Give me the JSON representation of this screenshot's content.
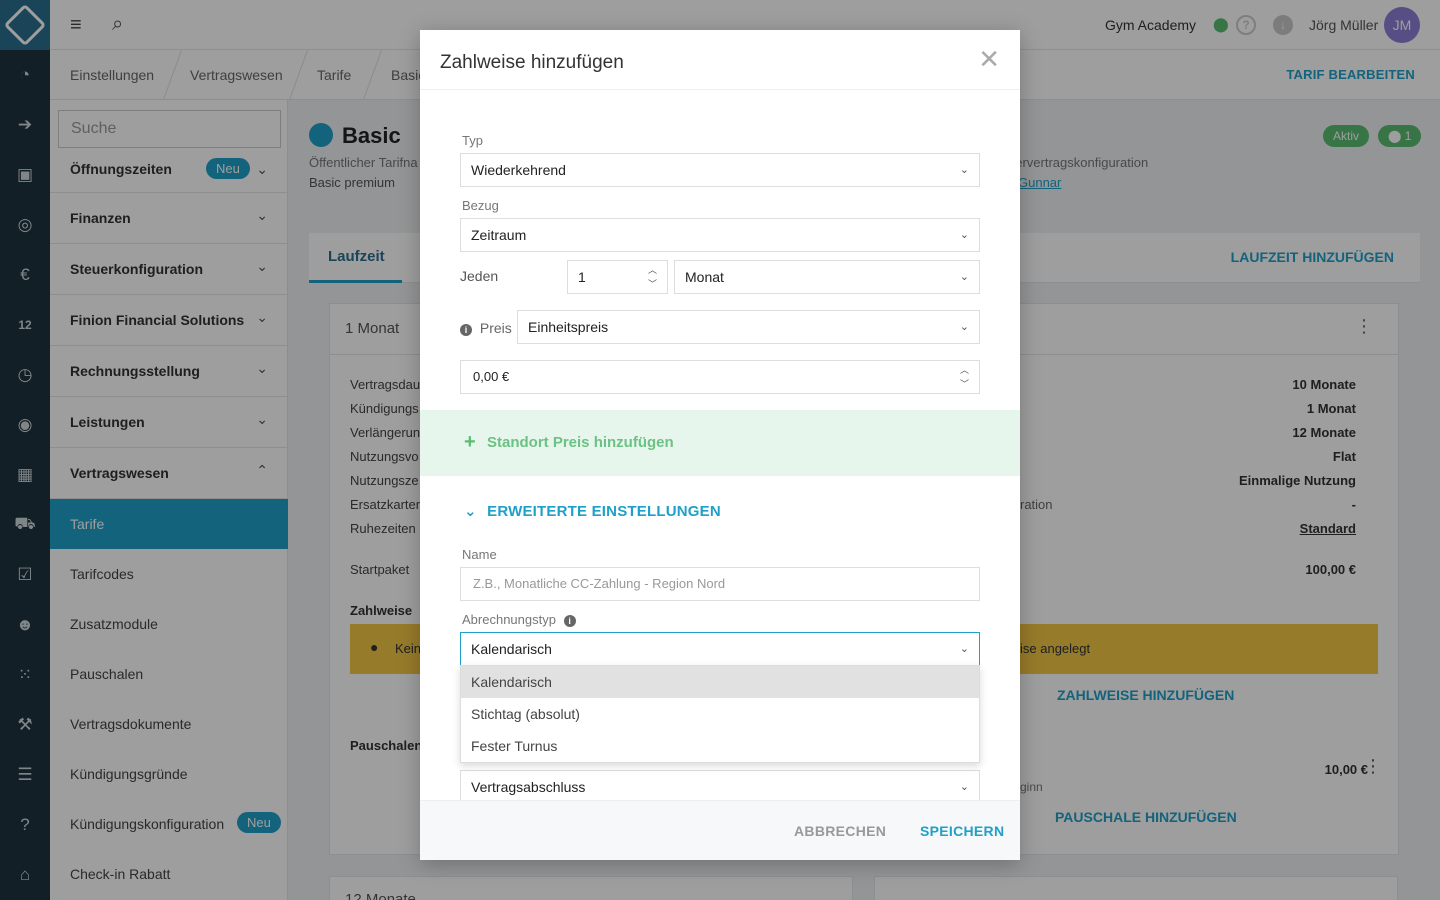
{
  "colors": {
    "accent": "#1fa0c9",
    "rail": "#1f3340",
    "success": "#5bbd72"
  },
  "topbar": {
    "studio": "Gym Academy",
    "user": "Jörg Müller",
    "avatar": "JM",
    "menu_icon": "hamburger-icon",
    "search_icon": "search-icon"
  },
  "rail_icons": [
    "dashboard-icon",
    "login-icon",
    "contacts-icon",
    "target-icon",
    "euro-icon",
    "calendar-icon",
    "timer-icon",
    "chat-icon",
    "chart-icon",
    "cart-icon",
    "check-icon",
    "users-icon",
    "grid-icon",
    "dumbbell-icon",
    "sliders-icon",
    "help-icon",
    "building-icon"
  ],
  "calendar_day": "12",
  "breadcrumb": {
    "items": [
      "Einstellungen",
      "Vertragswesen",
      "Tarife",
      "Basic"
    ],
    "edit_label": "TARIF BEARBEITEN"
  },
  "leftnav": {
    "search_placeholder": "Suche",
    "sections": [
      "Öffnungszeiten",
      "Finanzen",
      "Steuerkonfiguration",
      "Finion Financial Solutions",
      "Rechnungsstellung",
      "Leistungen",
      "Vertragswesen"
    ],
    "new_badge": "Neu",
    "sub_items": [
      "Tarife",
      "Tarifcodes",
      "Zusatzmodule",
      "Pauschalen",
      "Vertragsdokumente",
      "Kündigungsgründe",
      "Kündigungskonfiguration",
      "Check-in Rabatt"
    ]
  },
  "main": {
    "title": "Basic",
    "subtitle1": "Öffentlicher Tarifna",
    "subtitle2": "Basic premium",
    "subtitle3": "nervertragskonfiguration",
    "subtitle4": "Gunnar",
    "status_active": "Aktiv",
    "status_locations": "1",
    "tab_label": "Laufzeit",
    "add_duration": "LAUFZEIT HINZUFÜGEN",
    "card_title": "1 Monat",
    "card_bottom_title": "12 Monate",
    "rows_left": [
      "Vertragsdau",
      "Kündigungs",
      "Verlängerun",
      "Nutzungsvo",
      "Nutzungsze",
      "Ersatzkarter",
      "Ruhezeiten"
    ],
    "row_config": "ration",
    "rows_right": [
      "10 Monate",
      "1 Monat",
      "12 Monate",
      "Flat",
      "Einmalige Nutzung",
      "-",
      "Standard"
    ],
    "startpaket_label": "Startpaket",
    "startpaket_value": "100,00 €",
    "zahlweise_label": "Zahlweise",
    "warning_left": "Kein",
    "warning_right": "ise angelegt",
    "add_zahlweise": "ZAHLWEISE HINZUFÜGEN",
    "pauschalen_label": "Pauschalen",
    "pauschale_value": "10,00 €",
    "pauschale_sub": "ginn",
    "add_pauschale": "PAUSCHALE HINZUFÜGEN"
  },
  "modal": {
    "title": "Zahlweise hinzufügen",
    "typ_label": "Typ",
    "typ_value": "Wiederkehrend",
    "bezug_label": "Bezug",
    "bezug_value": "Zeitraum",
    "jeden_label": "Jeden",
    "jeden_value": "1",
    "interval_value": "Monat",
    "preis_label": "Preis",
    "preis_type": "Einheitspreis",
    "preis_value": "0,00 €",
    "add_location_price": "Standort Preis hinzufügen",
    "advanced": "ERWEITERTE EINSTELLUNGEN",
    "name_label": "Name",
    "name_placeholder": "Z.B., Monatliche CC-Zahlung - Region Nord",
    "abrechnungstyp_label": "Abrechnungstyp",
    "abrechnungstyp_value": "Kalendarisch",
    "options": [
      "Kalendarisch",
      "Stichtag (absolut)",
      "Fester Turnus"
    ],
    "next_value": "Vertragsabschluss",
    "cancel": "ABBRECHEN",
    "save": "SPEICHERN"
  }
}
